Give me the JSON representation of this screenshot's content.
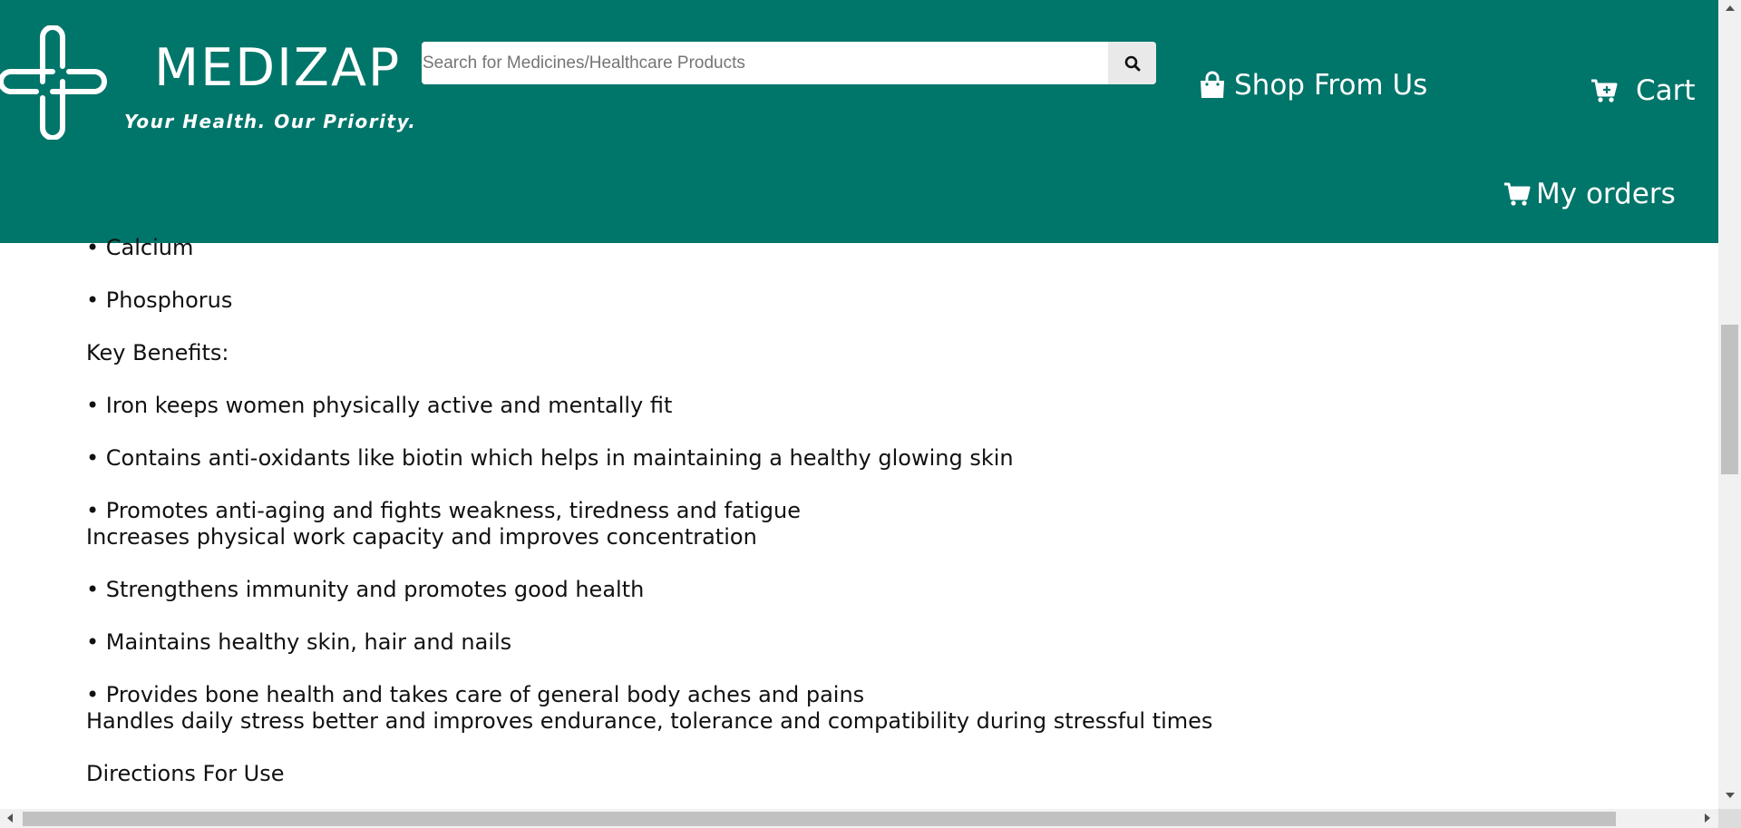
{
  "brand": {
    "name": "MEDIZAP",
    "tagline": "Your Health. Our Priority."
  },
  "search": {
    "placeholder": "Search for Medicines/Healthcare Products",
    "value": ""
  },
  "nav": {
    "shop_label": "Shop From Us",
    "cart_label": "Cart",
    "orders_label": "My orders"
  },
  "content": {
    "lines": [
      "• Calcium",
      "• Phosphorus",
      "Key Benefits:",
      "• Iron keeps women physically active and mentally fit",
      "• Contains anti-oxidants like biotin which helps in maintaining a healthy glowing skin",
      "• Promotes anti-aging and fights weakness, tiredness and fatigue",
      "Increases physical work capacity and improves concentration",
      "• Strengthens immunity and promotes good health",
      "• Maintains healthy skin, hair and nails",
      "• Provides bone health and takes care of general body aches and pains",
      "Handles daily stress better and improves endurance, tolerance and compatibility during stressful times",
      "Directions For Use"
    ]
  },
  "colors": {
    "header": "#00756a",
    "text": "#111111"
  },
  "icons": {
    "logo": "medical-cross-logo",
    "search": "search-icon",
    "shop": "shopping-bag-icon",
    "cart": "cart-plus-icon",
    "orders": "shopping-cart-icon"
  }
}
